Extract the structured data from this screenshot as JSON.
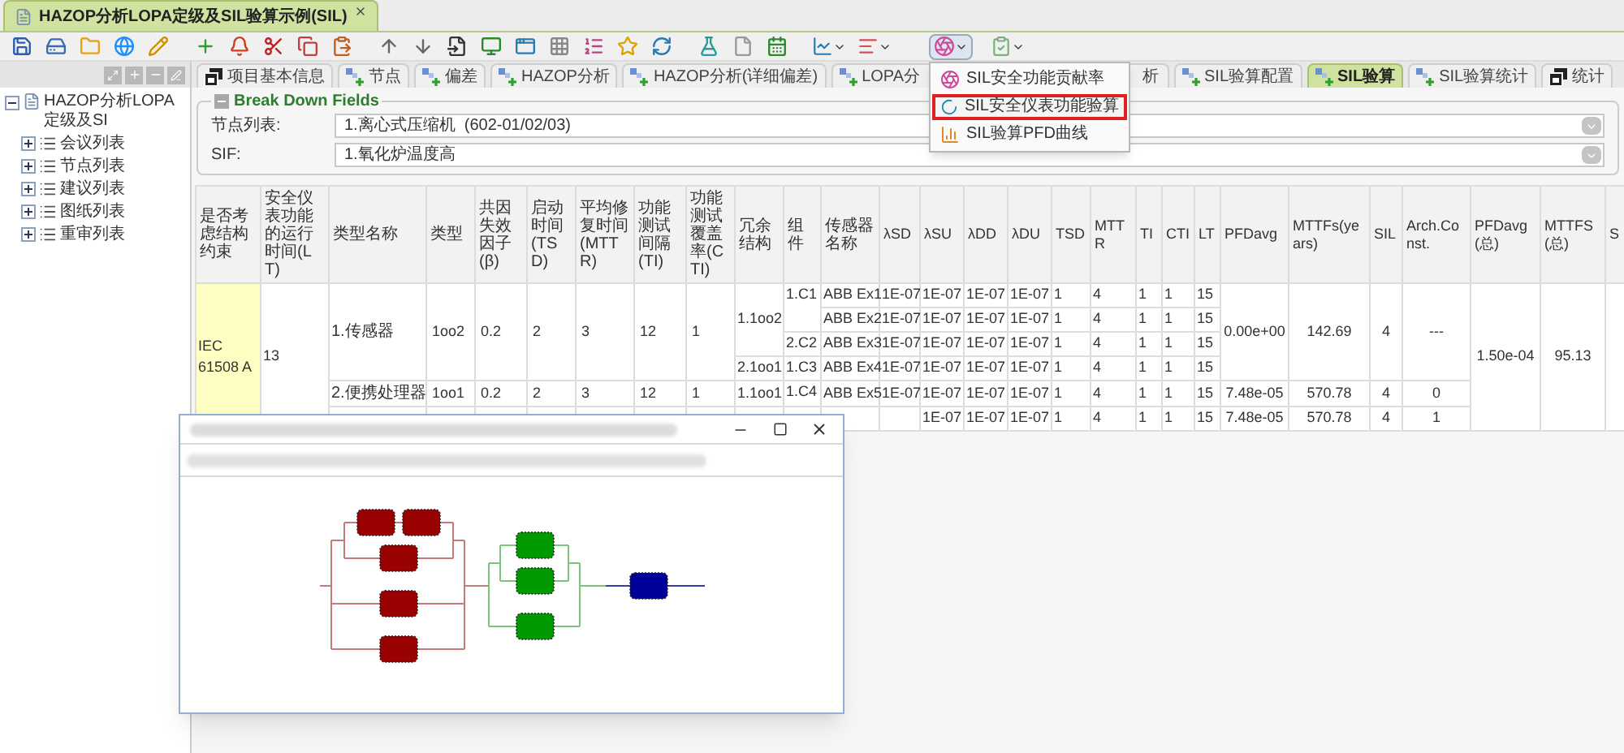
{
  "document_tab": {
    "title": "HAZOP分析LOPA定级及SIL验算示例(SIL)",
    "selected": true
  },
  "toolbar": {
    "menu_open": true
  },
  "menu": {
    "items": [
      {
        "label": "SIL安全功能贡献率",
        "selected": false
      },
      {
        "label": "SIL安全仪表功能验算",
        "selected": true
      },
      {
        "label": "SIL验算PFD曲线",
        "selected": false
      }
    ]
  },
  "tree": {
    "label": "HAZOP分析LOPA定级及SI",
    "expanded": true,
    "children": [
      {
        "label": "会议列表",
        "expanded": false
      },
      {
        "label": "节点列表",
        "expanded": false
      },
      {
        "label": "建议列表",
        "expanded": false
      },
      {
        "label": "图纸列表",
        "expanded": false
      },
      {
        "label": "重审列表",
        "expanded": false
      }
    ]
  },
  "tabs": [
    {
      "label": "项目基本信息",
      "kind": "info",
      "selected": false
    },
    {
      "label": "节点",
      "kind": "page",
      "selected": false
    },
    {
      "label": "偏差",
      "kind": "page",
      "selected": false
    },
    {
      "label": "HAZOP分析",
      "kind": "page",
      "selected": false
    },
    {
      "label": "HAZOP分析(详细偏差)",
      "kind": "page",
      "selected": false
    },
    {
      "label": "LOPA分",
      "kind": "cut",
      "selected": false
    },
    {
      "label": "析",
      "kind": "covered",
      "selected": false
    },
    {
      "label": "SIL验算配置",
      "kind": "page",
      "selected": false
    },
    {
      "label": "SIL验算",
      "kind": "page",
      "selected": true
    },
    {
      "label": "SIL验算统计",
      "kind": "page",
      "selected": false
    },
    {
      "label": "统计",
      "kind": "info",
      "selected": false
    }
  ],
  "fieldset": {
    "legend": "Break Down Fields",
    "fields": [
      {
        "label": "节点列表:",
        "value": "1.离心式压缩机  (602-01/02/03)"
      },
      {
        "label": "SIF:",
        "value": "1.氧化炉温度高"
      }
    ]
  },
  "table": {
    "columns": [
      "是否考虑结构约束",
      "安全仪表功能的运行时间(LT)",
      "类型名称",
      "类型",
      "共因失效因子(β)",
      "启动时间(TSD)",
      "平均修复时间(MTTR)",
      "功能测试间隔(TI)",
      "功能测试覆盖率(CTI)",
      "冗余结构",
      "组件",
      "传感器名称",
      "λSD",
      "λSU",
      "λDD",
      "λDU",
      "TSD",
      "MTTR",
      "TI",
      "CTI",
      "LT",
      "PFDavg",
      "MTTFs(years)",
      "SIL",
      "Arch.Const.",
      "PFDavg(总)",
      "MTTFS(总)",
      "S"
    ],
    "groups": [
      {
        "constraint": "IEC 61508 A",
        "lt": "13",
        "pfdavg_total": "1.50e-04",
        "mttfs_total": "95.13",
        "types": [
          {
            "name": "1.传感器",
            "type": "1oo2",
            "beta": "0.2",
            "tsd": "2",
            "mttr": "3",
            "ti": "12",
            "cti": "1",
            "pfdavg": "0.00e+00",
            "mttfs": "142.69",
            "sil": "4",
            "arch": "---",
            "redundancies": [
              {
                "structure": "1.1oo2",
                "components": [
                  {
                    "name": "1.C1",
                    "sensors": [
                      {
                        "name": "ABB Ex1",
                        "lsd": "1E-07",
                        "lsu": "1E-07",
                        "ldd": "1E-07",
                        "ldu": "1E-07",
                        "tsd": "1",
                        "mttr": "4",
                        "ti": "1",
                        "cti": "1",
                        "lt": "15"
                      },
                      {
                        "name": "ABB Ex2",
                        "lsd": "1E-07",
                        "lsu": "1E-07",
                        "ldd": "1E-07",
                        "ldu": "1E-07",
                        "tsd": "1",
                        "mttr": "4",
                        "ti": "1",
                        "cti": "1",
                        "lt": "15"
                      }
                    ]
                  },
                  {
                    "name": "2.C2",
                    "sensors": [
                      {
                        "name": "ABB Ex3",
                        "lsd": "1E-07",
                        "lsu": "1E-07",
                        "ldd": "1E-07",
                        "ldu": "1E-07",
                        "tsd": "1",
                        "mttr": "4",
                        "ti": "1",
                        "cti": "1",
                        "lt": "15"
                      }
                    ]
                  }
                ]
              },
              {
                "structure": "2.1oo1",
                "components": [
                  {
                    "name": "1.C3",
                    "sensors": [
                      {
                        "name": "ABB Ex4",
                        "lsd": "1E-07",
                        "lsu": "1E-07",
                        "ldd": "1E-07",
                        "ldu": "1E-07",
                        "tsd": "1",
                        "mttr": "4",
                        "ti": "1",
                        "cti": "1",
                        "lt": "15"
                      }
                    ]
                  }
                ]
              }
            ]
          },
          {
            "name": "2.便携处理器",
            "type": "1oo1",
            "beta": "0.2",
            "tsd": "2",
            "mttr": "3",
            "ti": "12",
            "cti": "1",
            "pfdavg": "7.48e-05",
            "mttfs": "570.78",
            "sil": "4",
            "arch": "0",
            "redundancies": [
              {
                "structure": "1.1oo1",
                "components": [
                  {
                    "name": "1.C4",
                    "sensors": [
                      {
                        "name": "ABB Ex5",
                        "lsd": "1E-07",
                        "lsu": "1E-07",
                        "ldd": "1E-07",
                        "ldu": "1E-07",
                        "tsd": "1",
                        "mttr": "4",
                        "ti": "1",
                        "cti": "1",
                        "lt": "15"
                      }
                    ]
                  }
                ]
              }
            ]
          },
          {
            "pfdavg": "7.48e-05",
            "mttfs": "570.78",
            "sil": "4",
            "arch": "1",
            "redundancies": [
              {
                "components": [
                  {
                    "sensors": [
                      {
                        "lsu": "1E-07",
                        "ldd": "1E-07",
                        "ldu": "1E-07",
                        "tsd": "1",
                        "mttr": "4",
                        "ti": "1",
                        "cti": "1",
                        "lt": "15"
                      }
                    ]
                  }
                ]
              }
            ]
          }
        ]
      }
    ]
  }
}
